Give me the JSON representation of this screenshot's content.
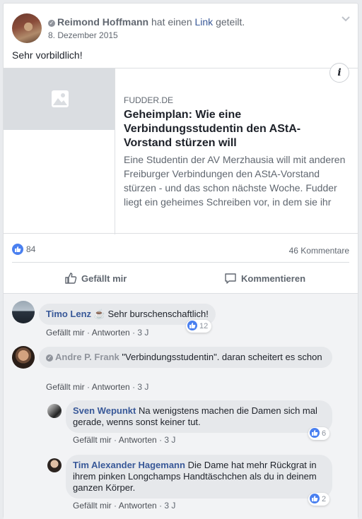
{
  "post": {
    "author": "Reimond Hoffmann",
    "action_prefix": "hat einen",
    "action_link": "Link",
    "action_suffix": "geteilt.",
    "date": "8. Dezember 2015",
    "text": "Sehr vorbildlich!"
  },
  "link_preview": {
    "domain": "FUDDER.DE",
    "headline": "Geheimplan: Wie eine Verbindungsstudentin den AStA-Vorstand stürzen will",
    "description": "Eine Studentin der AV Merzhausia will mit anderen Freiburger Verbindungen den AStA-Vorstand stürzen - und das schon nächste Woche. Fudder liegt ein geheimes Schreiben vor, in dem sie ihr"
  },
  "stats": {
    "likes": "84",
    "comments": "46 Kommentare"
  },
  "actions": {
    "like": "Gefällt mir",
    "comment": "Kommentieren"
  },
  "comments": [
    {
      "name": "Timo Lenz",
      "emoji": "☕",
      "text": "Sehr burschenschaftlich!",
      "like": "Gefällt mir",
      "reply": "Antworten",
      "time": "3 J",
      "likes": "12"
    },
    {
      "name": "Andre P. Frank",
      "text": "\"Verbindungsstudentin\". daran scheitert es schon",
      "like": "Gefällt mir",
      "reply": "Antworten",
      "time": "3 J"
    },
    {
      "name": "Sven Wepunkt",
      "text": "Na wenigstens machen die Damen sich mal gerade, wenns sonst keiner tut.",
      "like": "Gefällt mir",
      "reply": "Antworten",
      "time": "3 J",
      "likes": "6"
    },
    {
      "name": "Tim Alexander Hagemann",
      "text": "Die Dame hat mehr Rückgrat in ihrem pinken Longchamps Handtäschchen als du in deinem ganzen Körper.",
      "like": "Gefällt mir",
      "reply": "Antworten",
      "time": "3 J",
      "likes": "2"
    }
  ],
  "colors": {
    "link": "#385898",
    "like_blue": "#4a80f0",
    "bubble": "#e6e8eb"
  },
  "meta_separator": "·"
}
